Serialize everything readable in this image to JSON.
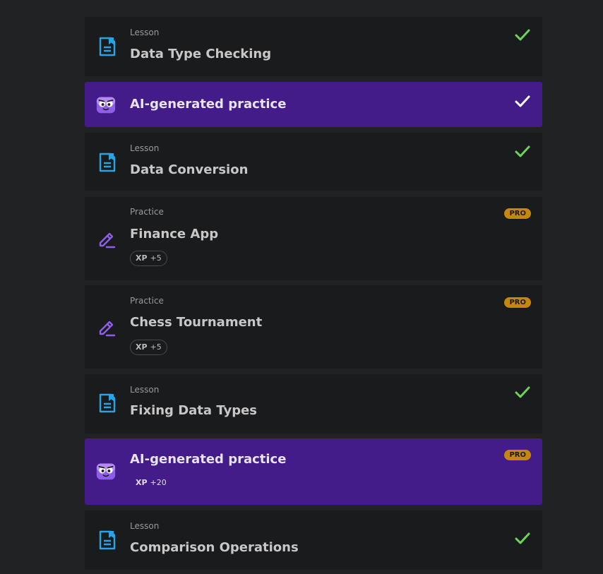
{
  "lessons": [
    {
      "kind": "Lesson",
      "title": "Data Type Checking",
      "status": "done"
    },
    {
      "kind": "",
      "title": "AI-generated practice",
      "status": "done",
      "variant": "ai"
    },
    {
      "kind": "Lesson",
      "title": "Data Conversion",
      "status": "done"
    },
    {
      "kind": "Practice",
      "title": "Finance App",
      "status": "pro",
      "badge": "PRO",
      "xp_label": "XP",
      "xp_value": "+5"
    },
    {
      "kind": "Practice",
      "title": "Chess Tournament",
      "status": "pro",
      "badge": "PRO",
      "xp_label": "XP",
      "xp_value": "+5"
    },
    {
      "kind": "Lesson",
      "title": "Fixing Data Types",
      "status": "done"
    },
    {
      "kind": "",
      "title": "AI-generated practice",
      "status": "pro",
      "variant": "ai",
      "badge": "PRO",
      "xp_label": "XP",
      "xp_value": "+20"
    },
    {
      "kind": "Lesson",
      "title": "Comparison Operations",
      "status": "done"
    }
  ],
  "colors": {
    "page_bg": "#202223",
    "card_bg": "#1a1b1d",
    "ai_card_bg": "#431c89",
    "check_green": "#6dd35a",
    "pro_badge": "#c7870e",
    "lesson_icon": "#2aa3e6",
    "practice_icon": "#8f5ee9"
  },
  "icons": {
    "lesson": "bookmark-document-icon",
    "practice": "pencil-edit-icon",
    "ai": "robot-mascot-icon",
    "done": "checkmark-icon"
  }
}
